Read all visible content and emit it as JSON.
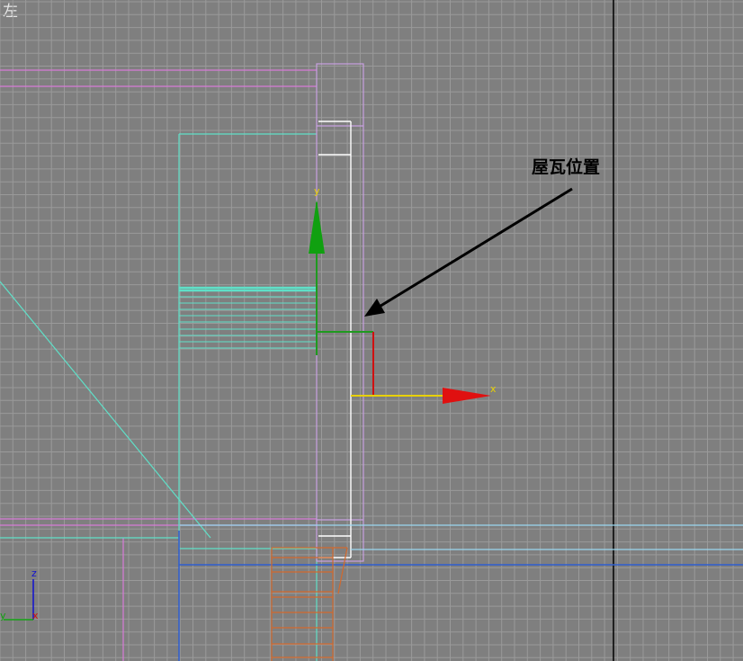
{
  "viewport": {
    "label": "左",
    "background": "#7f7f7f",
    "grid_color": "#9a9a9a"
  },
  "annotation": {
    "text": "屋瓦位置",
    "color": "#000000"
  },
  "gizmo": {
    "x_label": "x",
    "y_label": "y",
    "x_color": "#e8d000",
    "y_color": "#1f9a1f",
    "arrow_x_color": "#e01010",
    "arrow_y_color": "#10a010"
  },
  "axis_tripod": {
    "z_label": "z",
    "y_label": "y",
    "x_label": "x",
    "z_color": "#1010d0",
    "y_color": "#10a010",
    "x_color": "#d01010"
  },
  "colors": {
    "magenta": "#d87ad8",
    "cyan": "#5fe0c8",
    "white": "#ffffff",
    "light_blue": "#9ad8f0",
    "blue": "#2f5fd0",
    "orange": "#d2692d",
    "lavender": "#c8a0e0"
  }
}
